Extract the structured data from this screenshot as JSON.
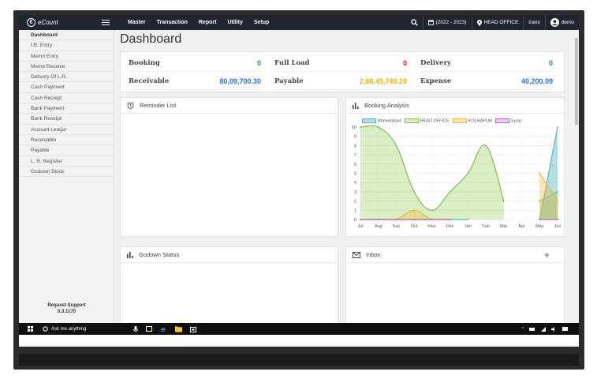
{
  "brand": {
    "name": "eCount"
  },
  "nav": {
    "menu": [
      "Master",
      "Transaction",
      "Report",
      "Utility",
      "Setup"
    ],
    "year": "(2022 - 2023)",
    "branch": "HEAD OFFICE",
    "trans": "trans",
    "user": "demo"
  },
  "sidebar": {
    "items": [
      "Dashboard",
      "LR. Entry",
      "Memo Entry",
      "Memo Receive",
      "Delivery Of L.R.",
      "Cash Payment",
      "Cash Receipt",
      "Bank Payment",
      "Bank Receipt",
      "Account Ledger",
      "Receivable",
      "Payable",
      "L. R. Register",
      "Godown Stock"
    ],
    "support_label": "Request Support",
    "version": "0.3.1170"
  },
  "page": {
    "title": "Dashboard"
  },
  "stats": {
    "booking": {
      "label": "Booking",
      "value": "0"
    },
    "full_load": {
      "label": "Full Load",
      "value": "0"
    },
    "delivery": {
      "label": "Delivery",
      "value": "0"
    },
    "receivable": {
      "label": "Receivable",
      "value": "80,09,700.30"
    },
    "payable": {
      "label": "Payable",
      "value": "2,66,45,749.20"
    },
    "expense": {
      "label": "Expense",
      "value": "40,200.09"
    }
  },
  "panels": {
    "reminder": "Reminder List",
    "booking_analysis": "Booking Analysis",
    "godown": "Godown Status",
    "inbox": "Inbox"
  },
  "colors": {
    "ahmedabad": "#5bb8c0",
    "head_office": "#7ec242",
    "kolhapur": "#f4b731",
    "surat": "#c85ec8"
  },
  "chart_data": {
    "type": "area",
    "x": [
      "Jul",
      "Aug",
      "Sep",
      "Oct",
      "Nov",
      "Dec",
      "Jan",
      "Feb",
      "Mar",
      "Apr",
      "May",
      "Jun"
    ],
    "ylim": [
      0,
      10
    ],
    "yticks": [
      0,
      1,
      2,
      3,
      4,
      5,
      6,
      7,
      8,
      9,
      10
    ],
    "series": [
      {
        "name": "Ahmedabad",
        "values": [
          0,
          0,
          0,
          0,
          0,
          0,
          0,
          null,
          null,
          null,
          0,
          10
        ]
      },
      {
        "name": "HEAD OFFICE",
        "values": [
          10,
          10,
          8,
          3,
          1,
          3,
          5,
          8,
          2,
          null,
          2,
          3
        ]
      },
      {
        "name": "KOLHAPUR",
        "values": [
          0,
          0,
          0,
          1,
          0,
          0,
          null,
          null,
          null,
          null,
          5,
          2
        ]
      },
      {
        "name": "Surat",
        "values": [
          0,
          0,
          0,
          0,
          0,
          0,
          null,
          null,
          null,
          null,
          0,
          0
        ]
      }
    ],
    "legend": "top"
  },
  "taskbar": {
    "search": "Ask me anything"
  }
}
